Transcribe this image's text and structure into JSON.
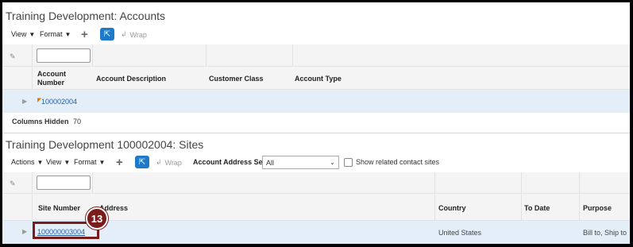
{
  "accounts": {
    "title": "Training Development: Accounts",
    "toolbar": {
      "view": "View",
      "format": "Format",
      "wrap": "Wrap"
    },
    "columns": [
      "Account Number",
      "Account Description",
      "Customer Class",
      "Account Type"
    ],
    "row": {
      "account_number": "100002004"
    },
    "columns_hidden_label": "Columns Hidden",
    "columns_hidden_count": "70"
  },
  "sites": {
    "title": "Training Development 100002004: Sites",
    "toolbar": {
      "actions": "Actions",
      "view": "View",
      "format": "Format",
      "wrap": "Wrap",
      "address_set_label": "Account Address Set",
      "address_set_value": "All",
      "show_related": "Show related contact sites"
    },
    "columns": [
      "Site Number",
      "Address",
      "Country",
      "To Date",
      "Purpose"
    ],
    "row": {
      "site_number": "100000003004",
      "country": "United States",
      "purpose": "Bill to, Ship to"
    }
  },
  "callout": {
    "step": "13",
    "color": "#7b1c1c"
  },
  "icons": [
    "pencil-icon",
    "plus-icon",
    "freeze-icon",
    "wrap-icon",
    "expand-icon",
    "flag-icon",
    "chevron-down-icon"
  ]
}
